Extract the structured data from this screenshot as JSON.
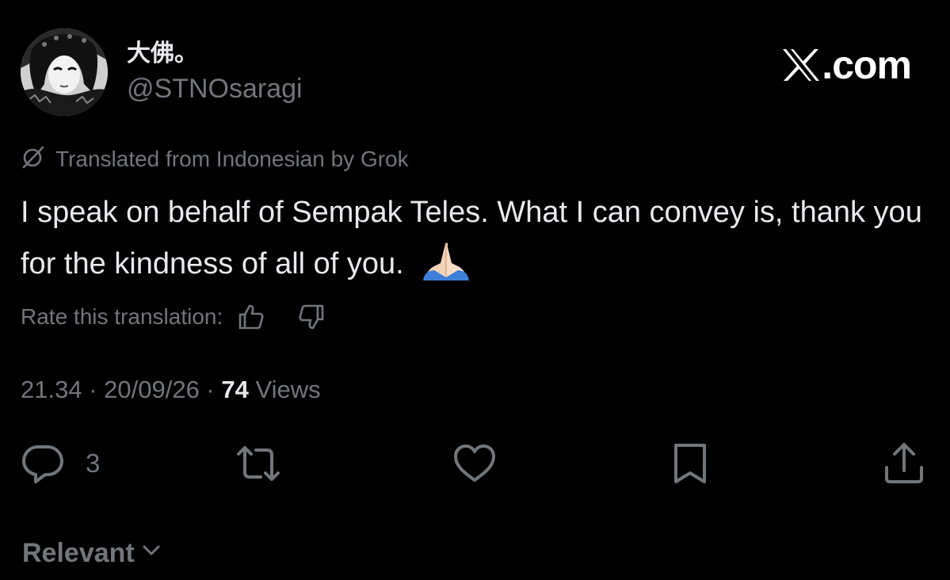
{
  "author": {
    "display_name": "大佛。",
    "handle": "@STNOsaragi"
  },
  "brand": {
    "text": ".com",
    "icon": "x-logo-icon"
  },
  "translation": {
    "note": "Translated from Indonesian by Grok",
    "rate_label": "Rate this translation:"
  },
  "tweet": {
    "text": "I speak on behalf of Sempak Teles. What I can convey is, thank you for the kindness of all of you.",
    "emoji": "🙏🏻"
  },
  "meta": {
    "time": "21.34",
    "separator": " · ",
    "date": "20/09/26",
    "views_count": "74",
    "views_label": " Views"
  },
  "actions": {
    "reply_count": "3",
    "icons": [
      "reply-icon",
      "repost-icon",
      "like-icon",
      "bookmark-icon",
      "share-icon"
    ]
  },
  "sort": {
    "label": "Relevant"
  },
  "colors": {
    "background": "#000000",
    "primary_text": "#e7e9ea",
    "secondary_text": "#71767b"
  }
}
